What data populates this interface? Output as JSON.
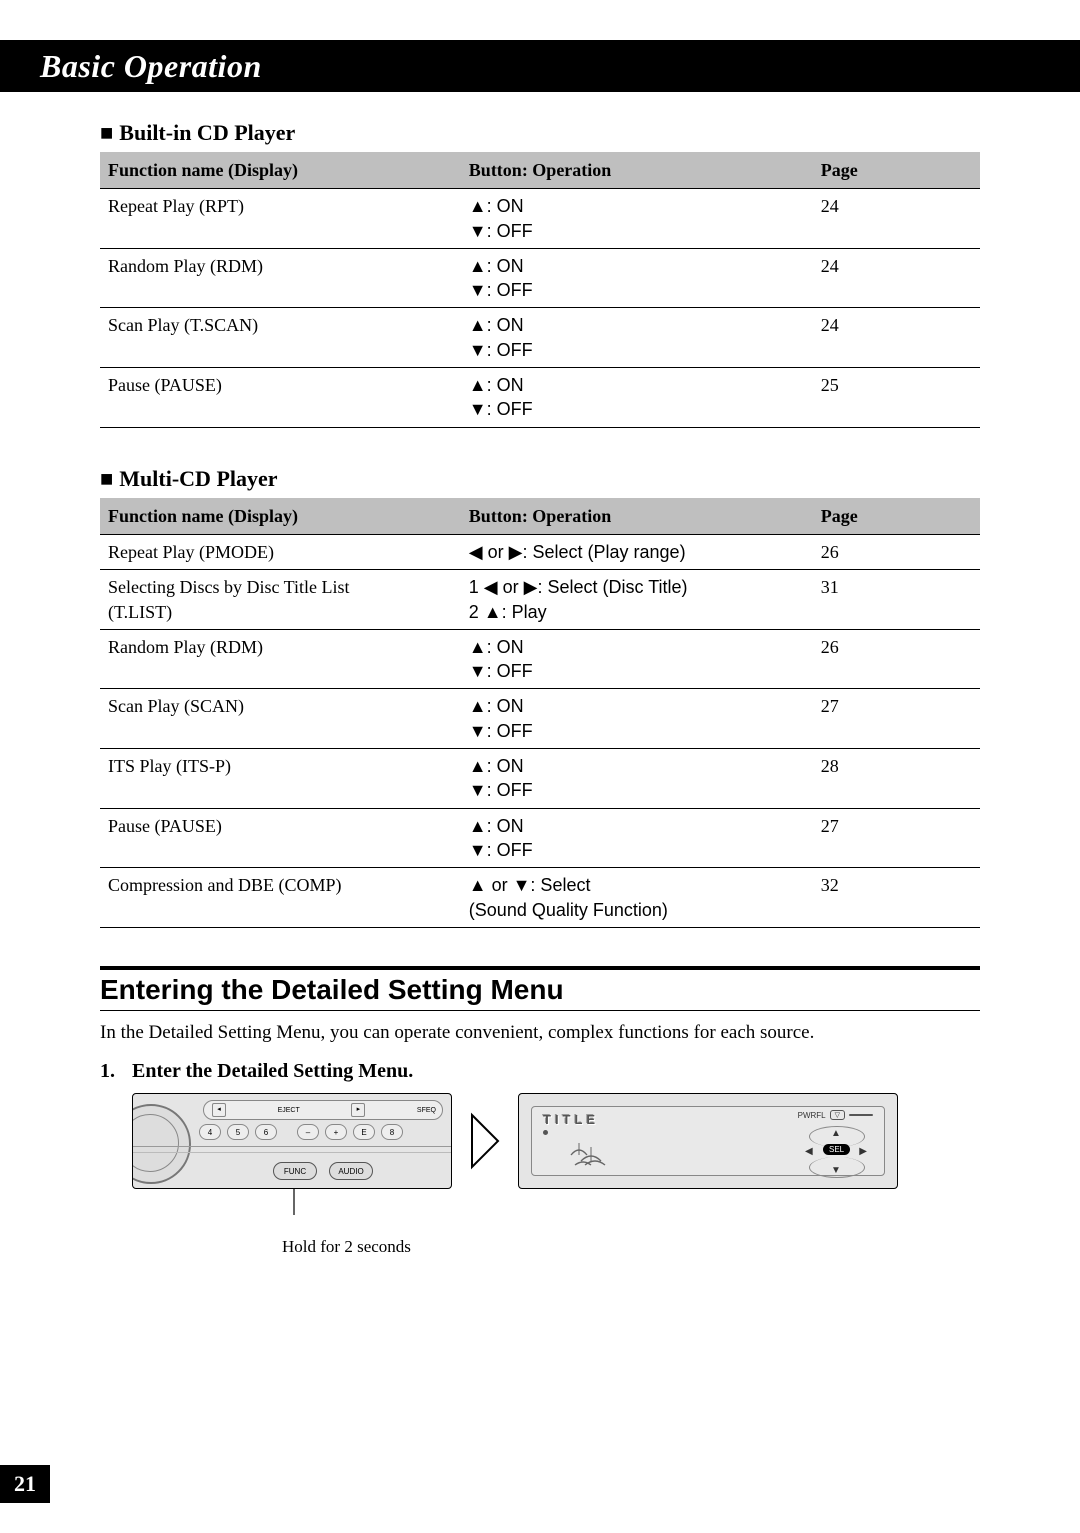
{
  "chapter_title": "Basic Operation",
  "tables": {
    "header": {
      "func": "Function name (Display)",
      "op": "Button: Operation",
      "page": "Page"
    },
    "builtin": {
      "heading": "Built-in CD Player",
      "rows": [
        {
          "func": "Repeat Play (RPT)",
          "op_l1": "▲: ON",
          "op_l2": "▼: OFF",
          "page": "24"
        },
        {
          "func": "Random Play (RDM)",
          "op_l1": "▲: ON",
          "op_l2": "▼: OFF",
          "page": "24"
        },
        {
          "func": "Scan Play (T.SCAN)",
          "op_l1": "▲: ON",
          "op_l2": "▼: OFF",
          "page": "24"
        },
        {
          "func": "Pause (PAUSE)",
          "op_l1": "▲: ON",
          "op_l2": "▼: OFF",
          "page": "25"
        }
      ]
    },
    "multicd": {
      "heading": "Multi-CD Player",
      "rows": [
        {
          "func": "Repeat Play (PMODE)",
          "func2": "",
          "op_l1": "◀ or ▶: Select (Play range)",
          "op_l2": "",
          "page": "26"
        },
        {
          "func": "Selecting Discs by Disc Title List",
          "func2": "(T.LIST)",
          "op_l1": "1 ◀ or ▶: Select (Disc Title)",
          "op_l2": "2 ▲: Play",
          "page": "31"
        },
        {
          "func": "Random Play (RDM)",
          "func2": "",
          "op_l1": "▲: ON",
          "op_l2": "▼: OFF",
          "page": "26"
        },
        {
          "func": "Scan Play (SCAN)",
          "func2": "",
          "op_l1": "▲: ON",
          "op_l2": "▼: OFF",
          "page": "27"
        },
        {
          "func": "ITS Play (ITS-P)",
          "func2": "",
          "op_l1": "▲: ON",
          "op_l2": "▼: OFF",
          "page": "28"
        },
        {
          "func": "Pause (PAUSE)",
          "func2": "",
          "op_l1": "▲: ON",
          "op_l2": "▼: OFF",
          "page": "27"
        },
        {
          "func": "Compression and DBE (COMP)",
          "func2": "",
          "op_l1": "▲ or ▼: Select",
          "op_l2": "(Sound Quality Function)",
          "page": "32"
        }
      ]
    }
  },
  "section": {
    "heading": "Entering the Detailed Setting Menu",
    "body": "In the Detailed Setting Menu, you can operate convenient, complex functions for each source.",
    "step_num": "1.",
    "step_text": "Enter the Detailed Setting Menu.",
    "caption": "Hold for 2 seconds",
    "panel_left": {
      "func_label": "FUNC",
      "audio_label": "AUDIO",
      "btns": [
        "4",
        "5",
        "6",
        "–",
        "+",
        "E",
        "8"
      ],
      "top_left": "EJECT",
      "top_right": "SFEQ"
    },
    "panel_right": {
      "title": "TITLE",
      "pwr_label": "PWRFL",
      "sel_label": "SEL"
    }
  },
  "page_number": "21"
}
